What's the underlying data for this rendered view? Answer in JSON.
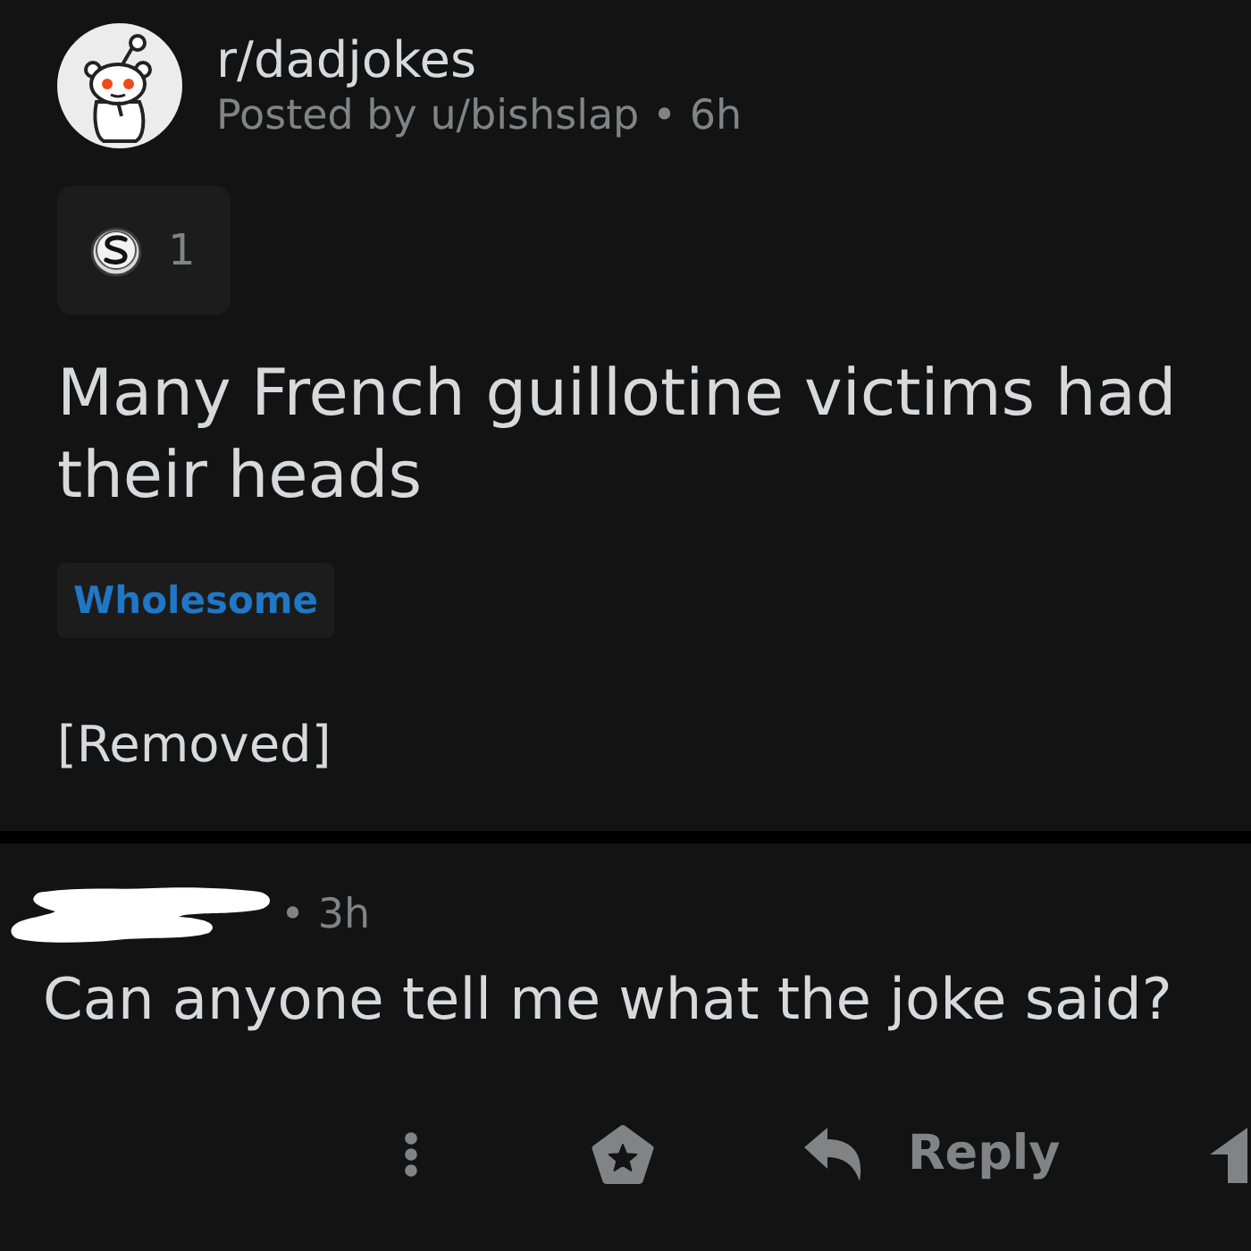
{
  "post": {
    "subreddit": "r/dadjokes",
    "meta": "Posted by u/bishslap • 6h",
    "award_count": "1",
    "title": "Many French guillotine victims had their heads",
    "flair": "Wholesome",
    "body": "[Removed]"
  },
  "comment": {
    "author_redacted": true,
    "time": "• 3h",
    "body": "Can anyone tell me what the joke said?",
    "actions": [
      {
        "kind": "more"
      },
      {
        "kind": "award"
      },
      {
        "kind": "reply",
        "label": "Reply"
      },
      {
        "kind": "upvote"
      }
    ]
  }
}
